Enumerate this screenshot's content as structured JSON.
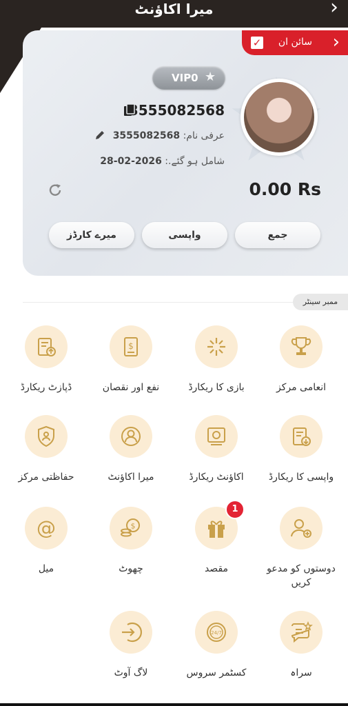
{
  "header": {
    "title": "میرا اکاؤنٹ"
  },
  "signin": {
    "label": "سائن ان"
  },
  "profile": {
    "vip_label": "VIP0",
    "uid": "3555082568",
    "nickname_label": "عرفی نام:",
    "nickname": "3555082568",
    "joined_label": "شامل ہو گئے.:",
    "joined_date": "2026-02-28",
    "balance": "0.00 Rs"
  },
  "actions": {
    "deposit": "جمع",
    "withdraw": "واپسی",
    "cards": "میرے کارڈز"
  },
  "section": {
    "title": "ممبر سینٹر"
  },
  "menu": [
    {
      "label": "انعامی مرکز",
      "icon": "trophy-icon"
    },
    {
      "label": "بازی کا ریکارڈ",
      "icon": "game-record-icon"
    },
    {
      "label": "نفع اور نقصان",
      "icon": "profit-loss-icon"
    },
    {
      "label": "ڈپازٹ ریکارڈ",
      "icon": "deposit-record-icon"
    },
    {
      "label": "واپسی کا ریکارڈ",
      "icon": "withdraw-record-icon"
    },
    {
      "label": "اکاؤنٹ ریکارڈ",
      "icon": "account-record-icon"
    },
    {
      "label": "میرا اکاؤنٹ",
      "icon": "user-icon"
    },
    {
      "label": "حفاظتی مرکز",
      "icon": "shield-icon"
    },
    {
      "label": "دوستوں کو مدعو کریں",
      "icon": "invite-icon"
    },
    {
      "label": "مقصد",
      "icon": "gift-icon",
      "badge": "1"
    },
    {
      "label": "چھوٹ",
      "icon": "coins-icon"
    },
    {
      "label": "میل",
      "icon": "mail-icon"
    },
    {
      "label": "سراہ",
      "icon": "feedback-icon"
    },
    {
      "label": "کسٹمر سروس",
      "icon": "support-icon"
    },
    {
      "label": "لاگ آوٹ",
      "icon": "logout-icon"
    }
  ],
  "colors": {
    "accent": "#c9a04a",
    "icon_bg": "#fbecd4",
    "signin_bg": "#d9202a",
    "header_bg": "#2a2421"
  }
}
